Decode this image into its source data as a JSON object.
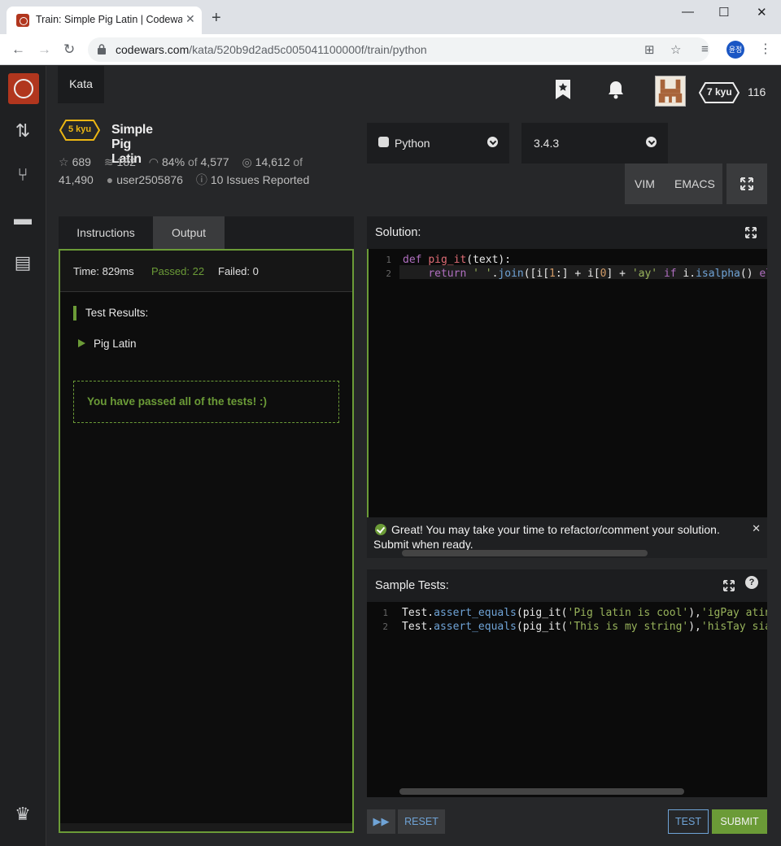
{
  "browser": {
    "tab_title": "Train: Simple Pig Latin | Codewars",
    "tab_close": "✕",
    "new_tab": "+",
    "url_host": "codewars.com",
    "url_path": "/kata/520b9d2ad5c005041100000f/train/python",
    "profile_initials": "윤정",
    "window_minimize": "—",
    "window_maximize": "☐",
    "window_close": "✕"
  },
  "topbar": {
    "kata_link": "Kata",
    "rank": "7 kyu",
    "honor": "116"
  },
  "kata": {
    "kyu": "5 kyu",
    "title": "Simple Pig Latin",
    "stars": "689",
    "collections": "182",
    "satisfaction": "84%",
    "satisfaction_of": "of",
    "satisfaction_votes": "4,577",
    "completed": "14,612",
    "completed_of": "of",
    "attempts": "41,490",
    "author": "user2505876",
    "issues": "10 Issues Reported"
  },
  "editor_settings": {
    "language": "Python",
    "version": "3.4.3",
    "vim": "VIM",
    "emacs": "EMACS"
  },
  "left_panel": {
    "tabs": [
      "Instructions",
      "Output"
    ],
    "active_tab": "Output",
    "time": "Time: 829ms",
    "passed": "Passed: 22",
    "failed": "Failed: 0",
    "results_header": "Test Results:",
    "test_group": "Pig Latin",
    "passed_message": "You have passed all of the tests! :)"
  },
  "solution": {
    "header": "Solution:",
    "lines": [
      "1",
      "2"
    ]
  },
  "notice": {
    "text": "Great! You may take your time to refactor/comment your solution. Submit when ready.",
    "close": "✕"
  },
  "sample_tests": {
    "header": "Sample Tests:",
    "help": "?",
    "lines": [
      "1",
      "2"
    ]
  },
  "actions": {
    "skip": "▶▶",
    "reset": "RESET",
    "test": "TEST",
    "submit": "SUBMIT"
  },
  "colors": {
    "accent_green": "#6b9b37",
    "accent_blue": "#6fa3d6",
    "brand_red": "#b1361e"
  }
}
